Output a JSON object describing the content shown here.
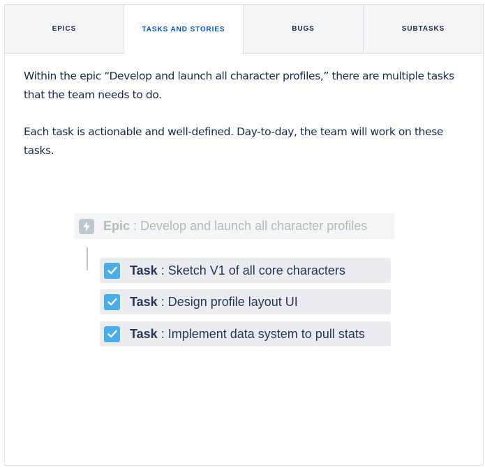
{
  "tabs": [
    {
      "label": "EPICS",
      "active": false
    },
    {
      "label": "TASKS AND STORIES",
      "active": true
    },
    {
      "label": "BUGS",
      "active": false
    },
    {
      "label": "SUBTASKS",
      "active": false
    }
  ],
  "content": {
    "paragraph_1": "Within the epic “Develop and launch all character profiles,” there are multiple tasks that the team needs to do.",
    "paragraph_2": "Each task is actionable and well-defined. Day-to-day, the team will work on these tasks."
  },
  "diagram": {
    "epic": {
      "type": "Epic",
      "separator": " : ",
      "title": "Develop and launch all character profiles",
      "icon": "lightning-icon"
    },
    "tasks": [
      {
        "type": "Task",
        "separator": " : ",
        "title": "Sketch V1 of all core characters",
        "icon": "checkbox-icon"
      },
      {
        "type": "Task",
        "separator": " : ",
        "title": "Design profile layout UI",
        "icon": "checkbox-icon"
      },
      {
        "type": "Task",
        "separator": " : ",
        "title": "Implement data system to pull stats",
        "icon": "checkbox-icon"
      }
    ]
  },
  "colors": {
    "active_tab_text": "#0052cc",
    "tab_background": "#f4f5f7",
    "task_icon": "#4bade8",
    "epic_icon": "#c1c7d0",
    "epic_text": "#b3bac5"
  }
}
